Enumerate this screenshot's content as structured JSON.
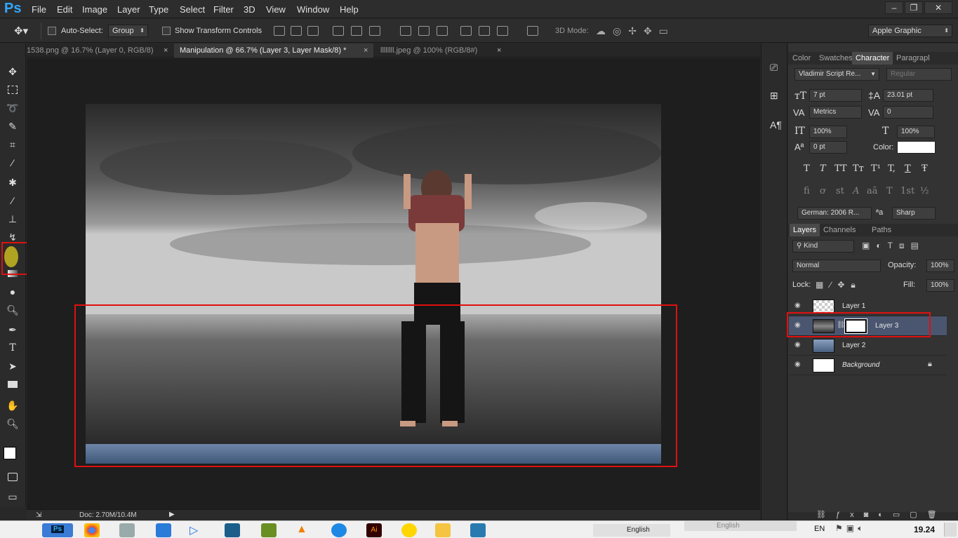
{
  "app": {
    "logo": "Ps"
  },
  "menu": [
    "File",
    "Edit",
    "Image",
    "Layer",
    "Type",
    "Select",
    "Filter",
    "3D",
    "View",
    "Window",
    "Help"
  ],
  "window_controls": {
    "minimize": "–",
    "restore": "❐",
    "close": "✕"
  },
  "options": {
    "auto_select_label": "Auto-Select:",
    "auto_select_value": "Group",
    "show_transform_label": "Show Transform Controls",
    "mode3d_label": "3D Mode:",
    "workspace": "Apple Graphic"
  },
  "tabs": [
    {
      "label": "1538.png @ 16.7% (Layer 0, RGB/8)",
      "close": "×"
    },
    {
      "label": "Manipulation @ 66.7% (Layer 3, Layer Mask/8) *",
      "close": "×"
    },
    {
      "label": "llllllll.jpeg @ 100% (RGB/8#)",
      "close": "×"
    }
  ],
  "status": {
    "doc": "Doc: 2.70M/10.4M"
  },
  "character": {
    "tabs": [
      "Color",
      "Swatches",
      "Character",
      "Paragrapl"
    ],
    "font_family": "Vladimir Script Re...",
    "font_style": "Regular",
    "size": "7 pt",
    "leading": "23.01 pt",
    "kerning": "Metrics",
    "tracking": "0",
    "vscale": "100%",
    "hscale": "100%",
    "baseline": "0 pt",
    "color_label": "Color:",
    "language": "German: 2006 R...",
    "aa_label": "ªa",
    "antialias": "Sharp",
    "type_buttons": [
      "T",
      "T",
      "TT",
      "Tт",
      "T¹",
      "T,",
      "T",
      "Ŧ"
    ],
    "ot_buttons": [
      "fi",
      "ơ",
      "st",
      "A",
      "aā",
      "T",
      "1st",
      "½"
    ]
  },
  "layers_panel": {
    "tabs": [
      "Layers",
      "Channels",
      "Paths"
    ],
    "filter": "Kind",
    "blend_mode": "Normal",
    "opacity_label": "Opacity:",
    "opacity": "100%",
    "lock_label": "Lock:",
    "fill_label": "Fill:",
    "fill": "100%",
    "layers": [
      {
        "name": "Layer 1"
      },
      {
        "name": "Layer 3"
      },
      {
        "name": "Layer 2"
      },
      {
        "name": "Background"
      }
    ]
  },
  "taskbar": {
    "lang": "EN",
    "lang_name": "English",
    "lang_name2": "English",
    "time": "19.24"
  },
  "colors": {
    "accent": "#31a8ff",
    "highlight_box": "#e01010",
    "selected_layer": "#4a5670"
  }
}
